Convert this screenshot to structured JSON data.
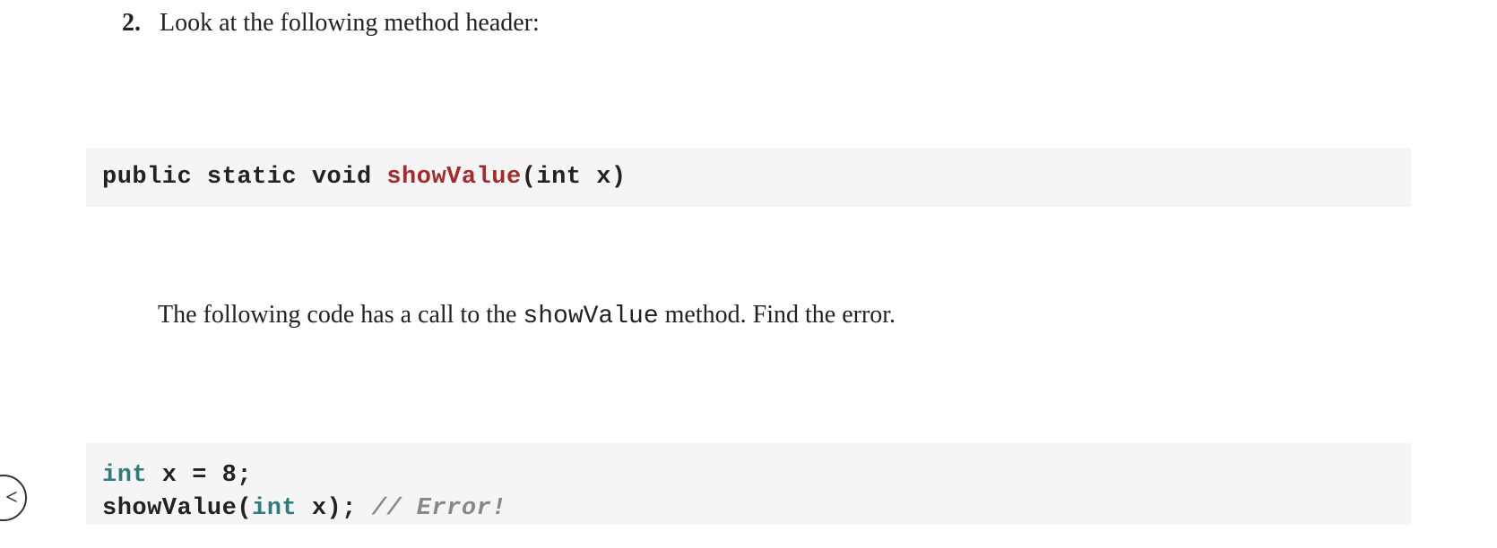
{
  "question": {
    "number": "2.",
    "prompt": "Look at the following method header:"
  },
  "code1": {
    "prefix": "public static void ",
    "method": "showValue",
    "suffix": "(int x)"
  },
  "paragraph": {
    "part1": "The following code has a call to the ",
    "inlineCode": "showValue",
    "part2": " method. Find the error."
  },
  "code2": {
    "line1_kw": "int",
    "line1_rest": " x = 8;",
    "line2_call": "showValue(",
    "line2_kw": "int",
    "line2_rest": " x); ",
    "line2_comment": "// Error!"
  },
  "nav": {
    "prevLabel": "<"
  }
}
